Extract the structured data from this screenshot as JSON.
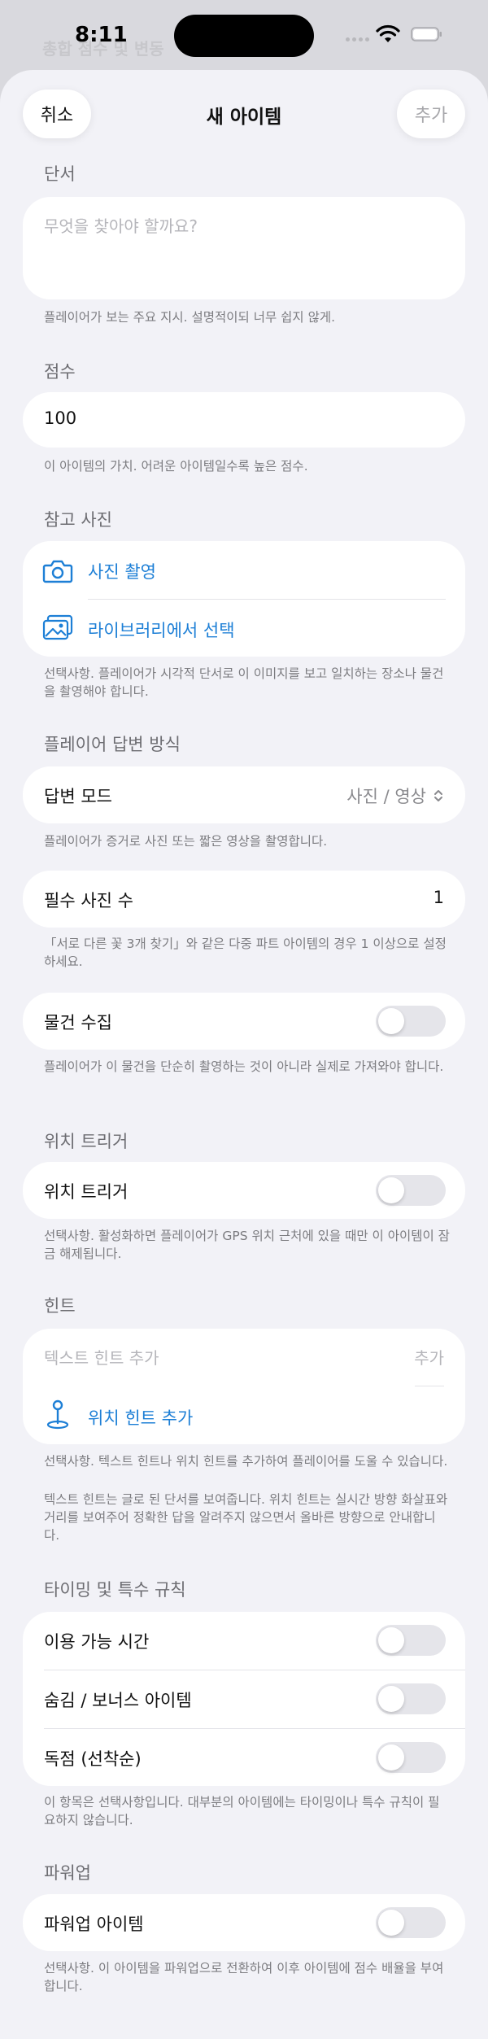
{
  "status": {
    "time": "8:11",
    "background_peek": "총합 점수 및 변동"
  },
  "nav": {
    "cancel": "취소",
    "title": "새 아이템",
    "add": "추가"
  },
  "clue": {
    "header": "단서",
    "placeholder": "무엇을 찾아야 할까요?",
    "caption": "플레이어가 보는 주요 지시. 설명적이되 너무 쉽지 않게."
  },
  "points": {
    "header": "점수",
    "value": "100",
    "caption": "이 아이템의 가치. 어려운 아이템일수록 높은 점수."
  },
  "reference_photo": {
    "header": "참고 사진",
    "take_photo": "사진 촬영",
    "choose_library": "라이브러리에서 선택",
    "caption": "선택사항. 플레이어가 시각적 단서로 이 이미지를 보고 일치하는 장소나 물건을 촬영해야 합니다."
  },
  "answer": {
    "header": "플레이어 답변 방식",
    "mode_label": "답변 모드",
    "mode_value": "사진 / 영상",
    "mode_caption": "플레이어가 증거로 사진 또는 짧은 영상을 촬영합니다.",
    "required_label": "필수 사진 수",
    "required_value": "1",
    "required_caption": "「서로 다른 꽃 3개 찾기」와 같은 다중 파트 아이템의 경우 1 이상으로 설정하세요.",
    "collect_label": "물건 수집",
    "collect_on": false,
    "collect_caption": "플레이어가 이 물건을 단순히 촬영하는 것이 아니라 실제로 가져와야 합니다."
  },
  "location": {
    "header": "위치 트리거",
    "label": "위치 트리거",
    "on": false,
    "caption": "선택사항. 활성화하면 플레이어가 GPS 위치 근처에 있을 때만 이 아이템이 잠금 해제됩니다."
  },
  "hints": {
    "header": "힌트",
    "text_placeholder": "텍스트 힌트 추가",
    "add": "추가",
    "location_hint": "위치 힌트 추가",
    "caption1": "선택사항. 텍스트 힌트나 위치 힌트를 추가하여 플레이어를 도울 수 있습니다.",
    "caption2": "텍스트 힌트는 글로 된 단서를 보여줍니다. 위치 힌트는 실시간 방향 화살표와 거리를 보여주어 정확한 답을 알려주지 않으면서 올바른 방향으로 안내합니다."
  },
  "timing": {
    "header": "타이밍 및 특수 규칙",
    "available_time": "이용 가능 시간",
    "hidden_bonus": "숨김 / 보너스 아이템",
    "exclusive": "독점 (선착순)",
    "caption": "이 항목은 선택사항입니다. 대부분의 아이템에는 타이밍이나 특수 규칙이 필요하지 않습니다."
  },
  "powerup": {
    "header": "파워업",
    "label": "파워업 아이템",
    "on": false,
    "caption": "선택사항. 이 아이템을 파워업으로 전환하여 이후 아이템에 점수 배율을 부여합니다."
  },
  "colors": {
    "accent": "#1d7fd6",
    "background": "#f2f2f7",
    "card": "#ffffff",
    "toggle_off": "#e5e5ea"
  }
}
